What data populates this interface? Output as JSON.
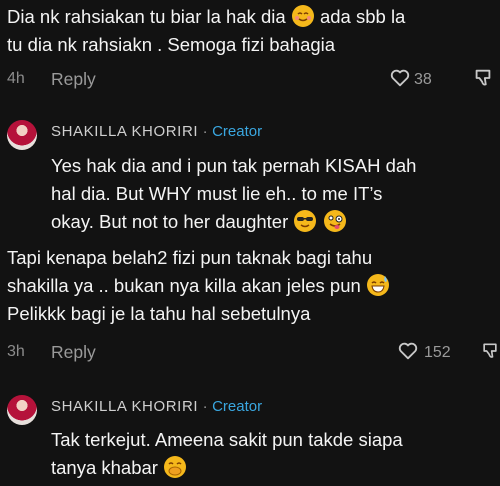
{
  "comments": [
    {
      "lines": [
        "Dia nk rahsiakan tu biar la hak dia",
        "ada sbb la",
        "tu dia nk rahsiakn . Semoga fizi bahagia"
      ],
      "time": "4h",
      "reply": "Reply",
      "likes": "38"
    },
    {
      "username": "SHAKILLA KHORIRI",
      "sep": "·",
      "badge": "Creator",
      "lines": [
        "Yes hak dia and i pun tak pernah KISAH dah",
        "hal dia. But WHY must lie eh.. to me IT’s",
        "okay. But not to her daughter"
      ]
    },
    {
      "lines": [
        "Tapi kenapa belah2 fizi pun taknak bagi tahu",
        "shakilla ya .. bukan nya killa akan jeles pun",
        "Pelikkk bagi je la tahu hal sebetulnya"
      ],
      "time": "3h",
      "reply": "Reply",
      "likes": "152"
    },
    {
      "username": "SHAKILLA KHORIRI",
      "sep": "·",
      "badge": "Creator",
      "lines": [
        "Tak terkejut. Ameena sakit pun takde siapa",
        "tanya khabar"
      ]
    }
  ]
}
